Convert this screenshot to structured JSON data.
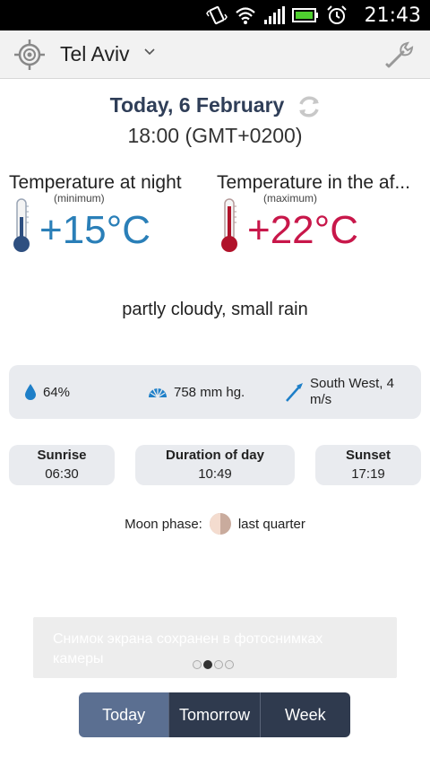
{
  "status_bar": {
    "time": "21:43"
  },
  "header": {
    "city": "Tel Aviv"
  },
  "date": "Today, 6 February",
  "time": "18:00 (GMT+0200)",
  "night": {
    "title": "Temperature at night",
    "subtitle": "(minimum)",
    "value": "+15°C"
  },
  "day": {
    "title": "Temperature in the af...",
    "subtitle": "(maximum)",
    "value": "+22°C"
  },
  "condition": "partly cloudy, small rain",
  "details": {
    "humidity": "64%",
    "pressure": "758 mm hg.",
    "wind": "South West, 4 m/s"
  },
  "sunrise": {
    "label": "Sunrise",
    "value": "06:30"
  },
  "duration": {
    "label": "Duration of day",
    "value": "10:49"
  },
  "sunset": {
    "label": "Sunset",
    "value": "17:19"
  },
  "moon": {
    "label": "Moon phase:",
    "value": "last quarter"
  },
  "toast": "Снимок экрана сохранен в фотоснимках камеры",
  "tabs": [
    "Today",
    "Tomorrow",
    "Week"
  ],
  "colors": {
    "night_temp": "#2a7fb8",
    "day_temp": "#c8174a",
    "tab_active": "#5b6f91",
    "tab": "#2f3a4e"
  }
}
